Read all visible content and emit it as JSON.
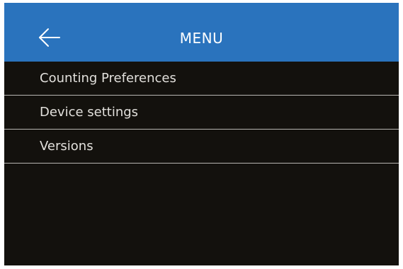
{
  "header": {
    "title": "MENU",
    "back_icon": "arrow-left-icon",
    "color": "#2a73bd"
  },
  "screen": {
    "background": "#13110d"
  },
  "menu": {
    "items": [
      {
        "label": "Counting Preferences"
      },
      {
        "label": "Device settings"
      },
      {
        "label": "Versions"
      }
    ]
  }
}
